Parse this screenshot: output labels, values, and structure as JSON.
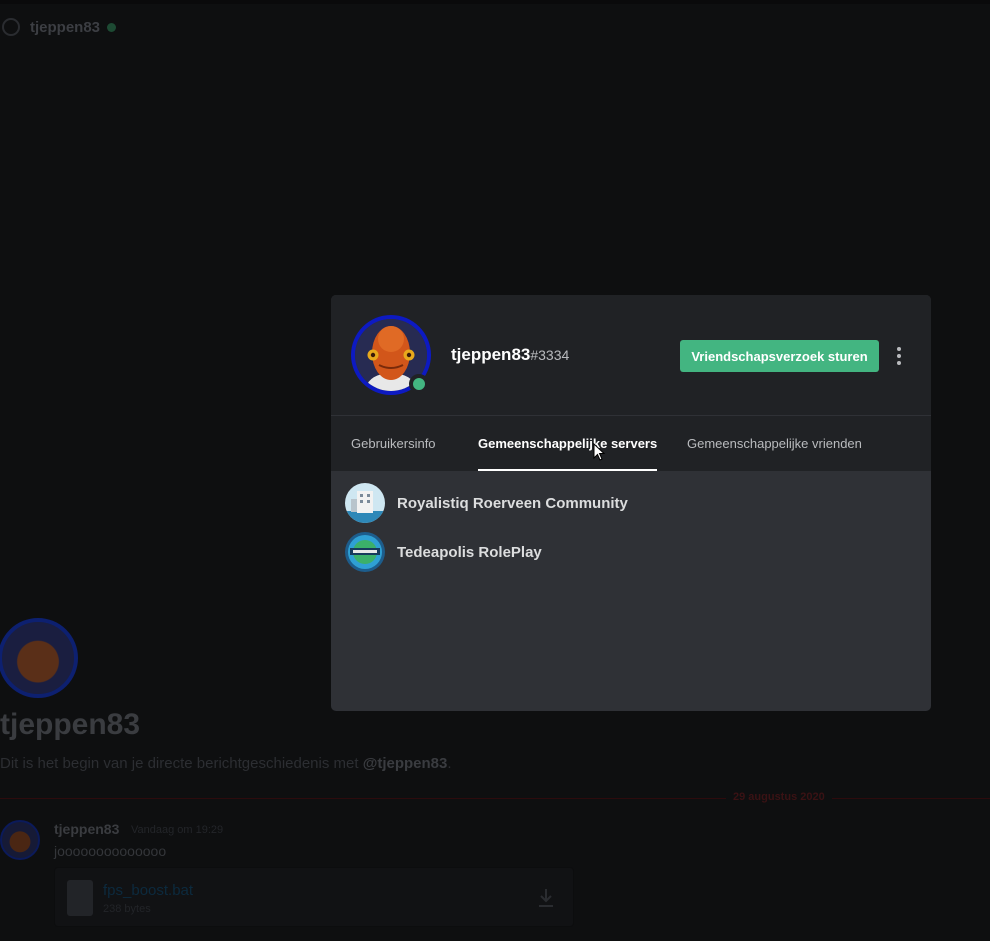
{
  "background": {
    "header_name": "tjeppen83",
    "title": "tjeppen83",
    "intro_prefix": "Dit is het begin van je directe berichtgeschiedenis met ",
    "intro_mention": "@tjeppen83",
    "intro_suffix": ".",
    "date_divider": "29 augustus 2020",
    "message": {
      "author": "tjeppen83",
      "timestamp": "Vandaag om 19:29",
      "text": "joooooooooooooo",
      "attachment": {
        "filename": "fps_boost.bat",
        "size": "238 bytes"
      }
    }
  },
  "profile": {
    "username": "tjeppen83",
    "discriminator": "#3334",
    "status": "online",
    "friend_request_label": "Vriendschapsverzoek sturen",
    "tabs": [
      {
        "label": "Gebruikersinfo",
        "active": false
      },
      {
        "label": "Gemeenschappelijke servers",
        "active": true
      },
      {
        "label": "Gemeenschappelijke vrienden",
        "active": false
      }
    ],
    "servers": [
      {
        "name": "Royalistiq Roerveen Community",
        "icon": "royalistiq-server-icon"
      },
      {
        "name": "Tedeapolis RolePlay",
        "icon": "tedeapolis-server-icon"
      }
    ]
  },
  "colors": {
    "online": "#43b581",
    "button": "#43b581",
    "modal_header": "#202225",
    "modal_body": "#2f3136",
    "avatar_ring": "#0d1ac2"
  }
}
